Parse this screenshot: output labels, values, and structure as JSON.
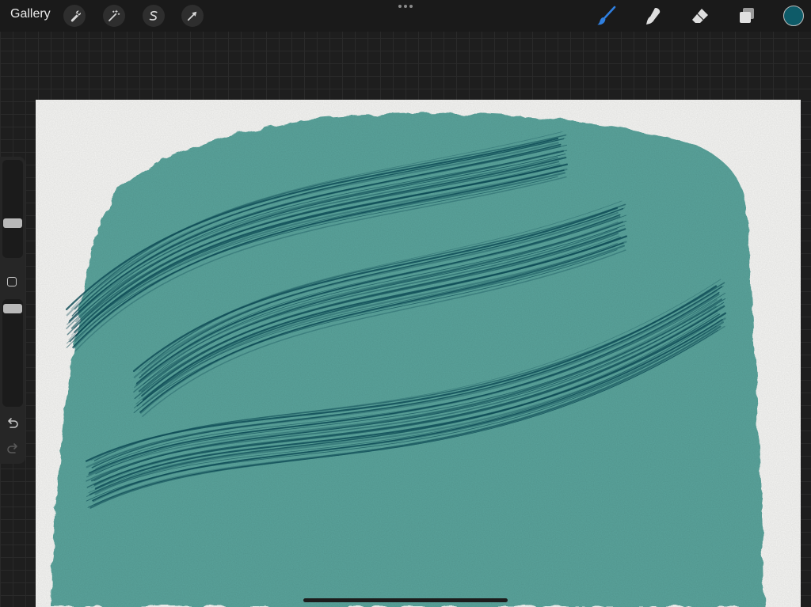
{
  "app": {
    "gallery_label": "Gallery"
  },
  "colors": {
    "current_color": "#0e5b68",
    "brush_active": "#2f7fe0",
    "wash": "#5aa49c",
    "stroke_dark": "#0d4b55"
  },
  "toolbar_left": [
    {
      "icon": "wrench-icon",
      "name": "actions"
    },
    {
      "icon": "magic-wand-icon",
      "name": "adjustments"
    },
    {
      "icon": "selection-s-icon",
      "name": "selection"
    },
    {
      "icon": "arrow-cursor-icon",
      "name": "transform"
    }
  ],
  "toolbar_right": [
    {
      "icon": "paintbrush-icon",
      "name": "brush",
      "active": true
    },
    {
      "icon": "smudge-finger-icon",
      "name": "smudge"
    },
    {
      "icon": "eraser-icon",
      "name": "eraser"
    },
    {
      "icon": "layers-icon",
      "name": "layers"
    }
  ],
  "sidebar": {
    "brush_size_level": 0.35,
    "opacity_level": 0.97
  }
}
